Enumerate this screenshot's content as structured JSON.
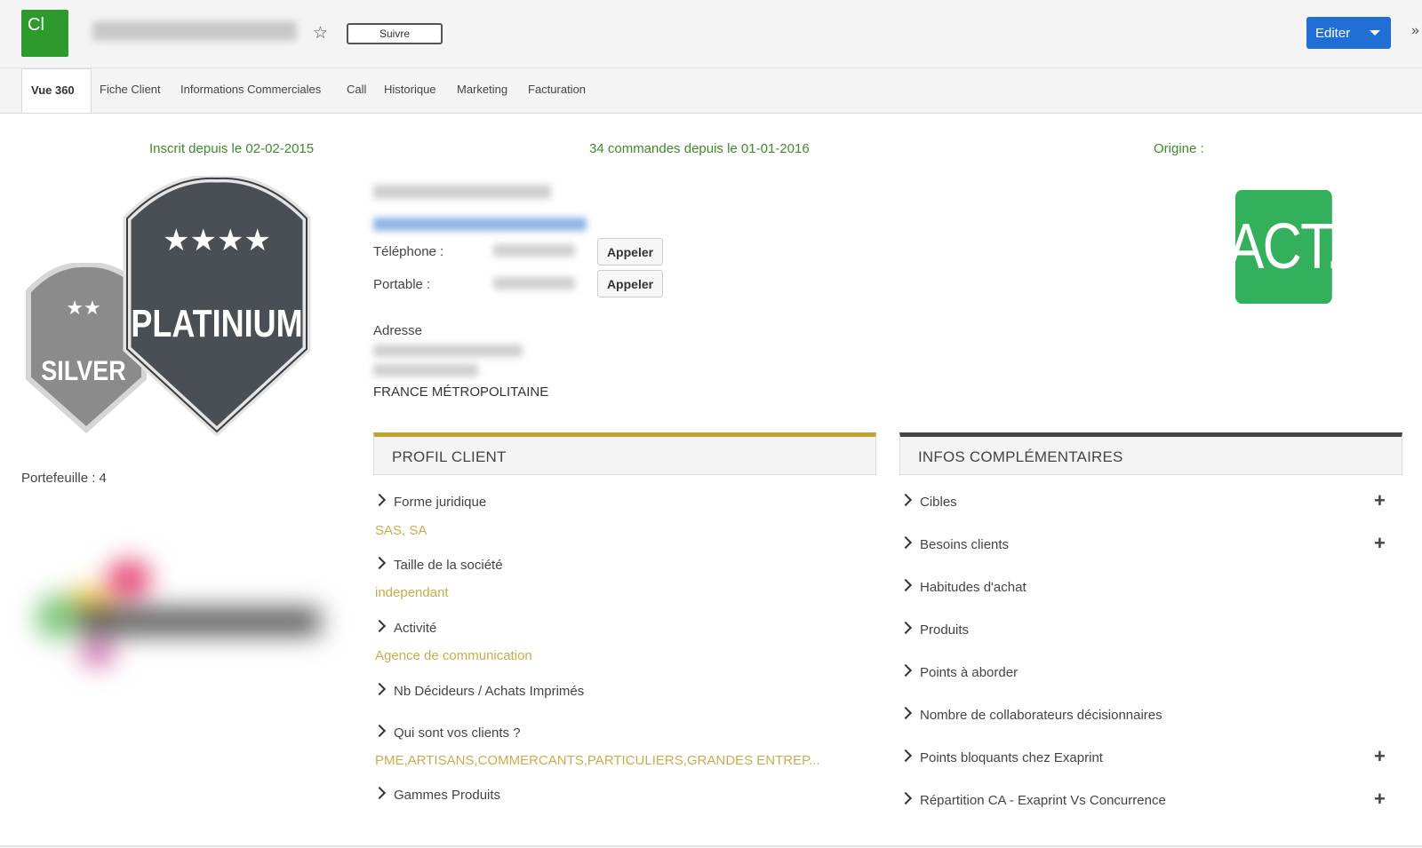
{
  "header": {
    "logo_text": "Cl",
    "follow_label": "Suivre",
    "edit_label": "Editer",
    "more_label": "»",
    "star_glyph": "☆"
  },
  "tabs": [
    {
      "label": "Vue 360",
      "active": true
    },
    {
      "label": "Fiche Client"
    },
    {
      "label": "Informations Commerciales"
    },
    {
      "label": "Call"
    },
    {
      "label": "Historique"
    },
    {
      "label": "Marketing"
    },
    {
      "label": "Facturation"
    }
  ],
  "summary": {
    "registered": "Inscrit depuis le 02-02-2015",
    "orders": "34 commandes depuis le 01-01-2016",
    "origin": "Origine :"
  },
  "badges": {
    "platinum_label": "PLATINIUM",
    "platinum_stars": "★★★★",
    "silver_label": "SILVER",
    "silver_stars": "★★"
  },
  "portfolio": "Portefeuille : 4",
  "contact": {
    "phone_label": "Téléphone :",
    "mobile_label": "Portable :",
    "call_label": "Appeler",
    "address_label": "Adresse",
    "country": "FRANCE MÉTROPOLITAINE"
  },
  "logo_right": {
    "text": "ACT.",
    "color": "#33b05c"
  },
  "profil": {
    "title": "PROFIL CLIENT",
    "accent": "#c5a333",
    "items": [
      {
        "label": "Forme juridique",
        "value": "SAS, SA"
      },
      {
        "label": "Taille de la société",
        "value": "independant"
      },
      {
        "label": "Activité",
        "value": "Agence de communication"
      },
      {
        "label": "Nb Décideurs / Achats Imprimés",
        "value": ""
      },
      {
        "label": "Qui sont vos clients ?",
        "value": "PME,ARTISANS,COMMERCANTS,PARTICULIERS,GRANDES ENTREP..."
      },
      {
        "label": "Gammes Produits",
        "value": ""
      }
    ]
  },
  "infos": {
    "title": "INFOS COMPLÉMENTAIRES",
    "accent": "#444444",
    "items": [
      {
        "label": "Cibles",
        "has_plus": true
      },
      {
        "label": "Besoins clients",
        "has_plus": true
      },
      {
        "label": "Habitudes d'achat",
        "has_plus": false
      },
      {
        "label": "Produits",
        "has_plus": false
      },
      {
        "label": "Points à aborder",
        "has_plus": false
      },
      {
        "label": "Nombre de collaborateurs décisionnaires",
        "has_plus": false
      },
      {
        "label": "Points bloquants chez Exaprint",
        "has_plus": true
      },
      {
        "label": "Répartition CA - Exaprint Vs Concurrence",
        "has_plus": true
      }
    ],
    "plus_glyph": "+"
  }
}
